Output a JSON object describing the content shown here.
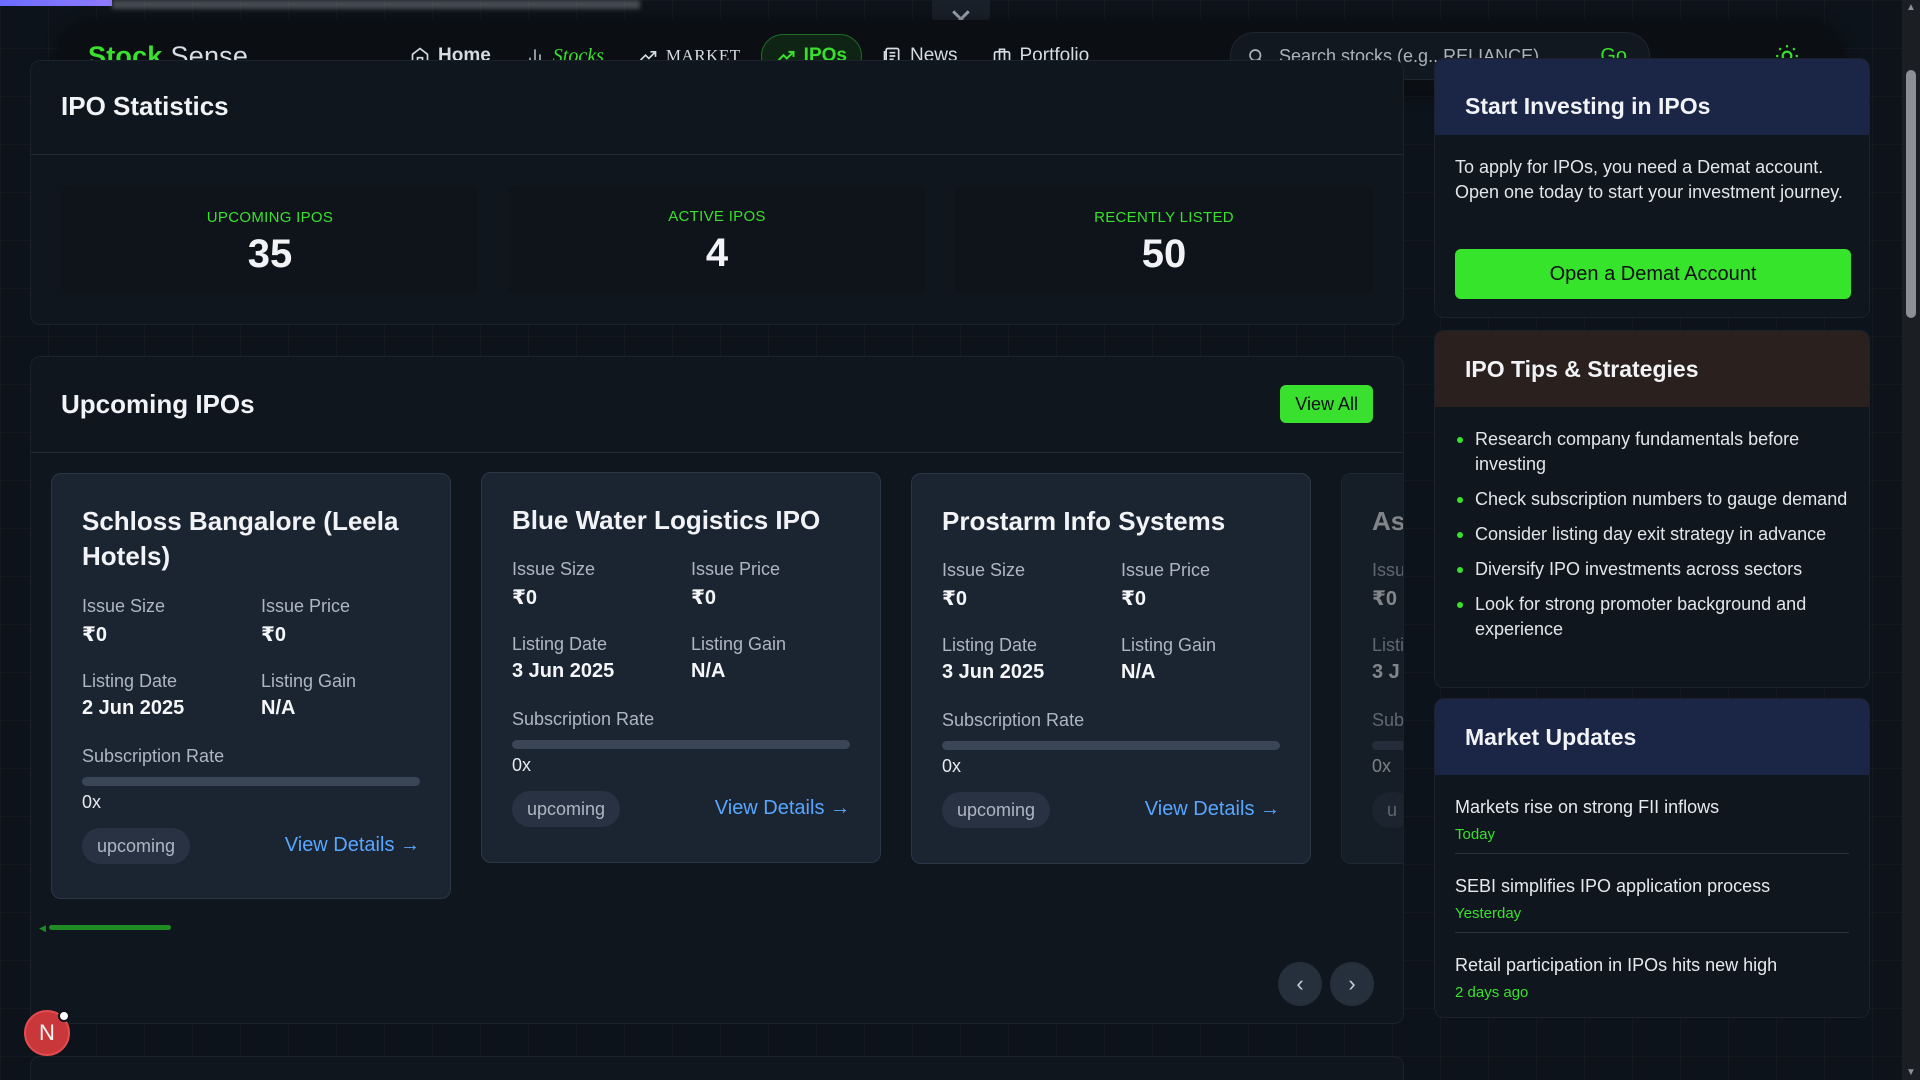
{
  "close_icon": "close-icon",
  "brand": {
    "part1": "Stock",
    "part2": "Sense"
  },
  "nav": {
    "home": "Home",
    "stocks": "Stocks",
    "market": "MARKET",
    "ipos": "IPOs",
    "news": "News",
    "portfolio": "Portfolio"
  },
  "search": {
    "placeholder": "Search stocks (e.g., RELIANCE)",
    "go": "Go"
  },
  "stats": {
    "title": "IPO Statistics",
    "items": [
      {
        "label": "UPCOMING IPOS",
        "value": "35"
      },
      {
        "label": "ACTIVE IPOS",
        "value": "4"
      },
      {
        "label": "RECENTLY LISTED",
        "value": "50"
      }
    ]
  },
  "upcoming": {
    "title": "Upcoming IPOs",
    "view_all": "View All",
    "labels": {
      "issue_size": "Issue Size",
      "issue_price": "Issue Price",
      "listing_date": "Listing Date",
      "listing_gain": "Listing Gain",
      "subscription_rate": "Subscription Rate",
      "view_details": "View Details →"
    },
    "cards": [
      {
        "name": "Schloss Bangalore (Leela Hotels)",
        "issue_size": "₹0",
        "issue_price": "₹0",
        "listing_date": "2 Jun 2025",
        "listing_gain": "N/A",
        "subscription": "0x",
        "subscription_fill": 0,
        "status": "upcoming"
      },
      {
        "name": "Blue Water Logistics IPO",
        "issue_size": "₹0",
        "issue_price": "₹0",
        "listing_date": "3 Jun 2025",
        "listing_gain": "N/A",
        "subscription": "0x",
        "subscription_fill": 0,
        "status": "upcoming"
      },
      {
        "name": "Prostarm Info Systems",
        "issue_size": "₹0",
        "issue_price": "₹0",
        "listing_date": "3 Jun 2025",
        "listing_gain": "N/A",
        "subscription": "0x",
        "subscription_fill": 0,
        "status": "upcoming"
      },
      {
        "name": "As",
        "issue_size": "₹0",
        "issue_price": "Iss",
        "listing_date": "3 J",
        "listing_gain": "Lis",
        "subscription": "0x",
        "subscription_fill": 0,
        "status": "u"
      }
    ],
    "prev_icon": "chevron-left-icon",
    "next_icon": "chevron-right-icon"
  },
  "sidebar": {
    "invest": {
      "title": "Start Investing in IPOs",
      "text": "To apply for IPOs, you need a Demat account. Open one today to start your investment journey.",
      "button": "Open a Demat Account"
    },
    "tips": {
      "title": "IPO Tips & Strategies",
      "items": [
        "Research company fundamentals before investing",
        "Check subscription numbers to gauge demand",
        "Consider listing day exit strategy in advance",
        "Diversify IPO investments across sectors",
        "Look for strong promoter background and experience"
      ]
    },
    "updates": {
      "title": "Market Updates",
      "items": [
        {
          "title": "Markets rise on strong FII inflows",
          "time": "Today"
        },
        {
          "title": "SEBI simplifies IPO application process",
          "time": "Yesterday"
        },
        {
          "title": "Retail participation in IPOs hits new high",
          "time": "2 days ago"
        }
      ]
    }
  },
  "avatar": {
    "initial": "N"
  },
  "colors": {
    "accent": "#39e02e",
    "link": "#58a6ff",
    "background": "#0d131a"
  }
}
